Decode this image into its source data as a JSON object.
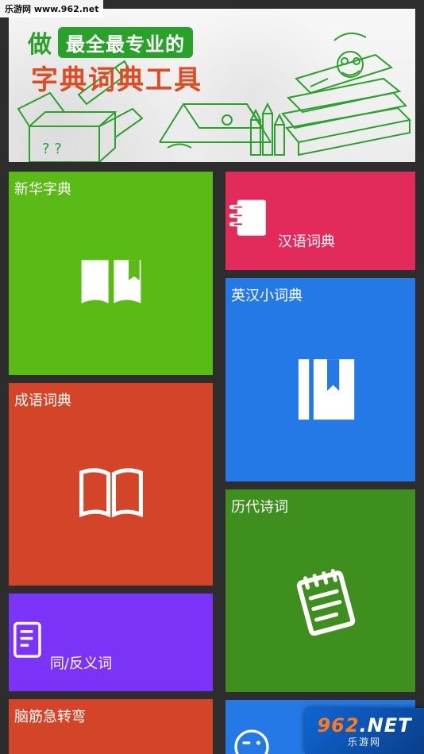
{
  "watermark_top": "乐游网 www.962.net",
  "banner": {
    "line1_char": "做",
    "line1_pill": "最全最专业的",
    "line2": "字典词典工具"
  },
  "tiles": {
    "xinhua": {
      "label": "新华字典",
      "color": "#5aba16"
    },
    "hanyu": {
      "label": "汉语词典",
      "color": "#e32b5b"
    },
    "yinghan": {
      "label": "英汉小词典",
      "color": "#2479e6"
    },
    "chengyu": {
      "label": "成语词典",
      "color": "#d44428"
    },
    "lidai": {
      "label": "历代诗词",
      "color": "#3f8f1f"
    },
    "tongfan": {
      "label": "同/反义词",
      "color": "#7b34f7"
    },
    "naojin": {
      "label": "脑筋急转弯",
      "color": "#d44428"
    },
    "bottom_right": {
      "label": "",
      "color": "#2479e6"
    }
  },
  "watermark_bottom": {
    "logo_prefix": "962",
    "logo_suffix": ".NET",
    "sub": "乐游网"
  }
}
